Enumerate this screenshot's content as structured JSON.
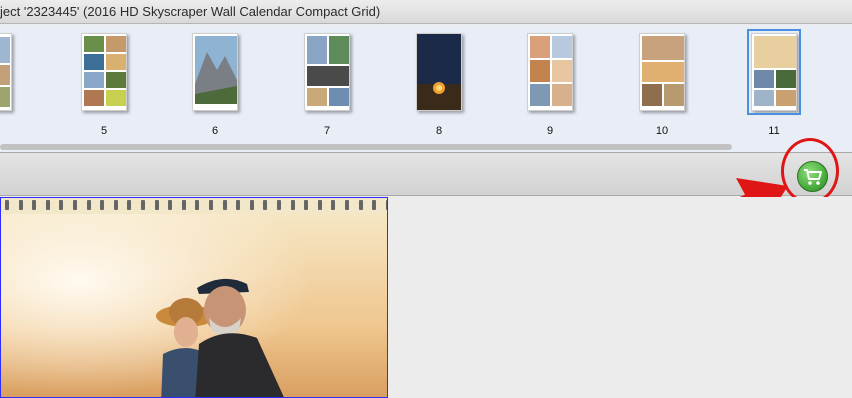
{
  "window": {
    "title": "ject '2323445' (2016 HD Skyscraper Wall Calendar Compact Grid)"
  },
  "filmstrip": {
    "pages": [
      {
        "label": "",
        "selected": false
      },
      {
        "label": "5",
        "selected": false
      },
      {
        "label": "6",
        "selected": false
      },
      {
        "label": "7",
        "selected": false
      },
      {
        "label": "8",
        "selected": false
      },
      {
        "label": "9",
        "selected": false
      },
      {
        "label": "10",
        "selected": false
      },
      {
        "label": "11",
        "selected": true
      }
    ]
  },
  "toolbar": {
    "cart_icon": "shopping-cart-icon",
    "accent": "#3fa535"
  },
  "annotation": {
    "highlight_color": "#e01616"
  }
}
